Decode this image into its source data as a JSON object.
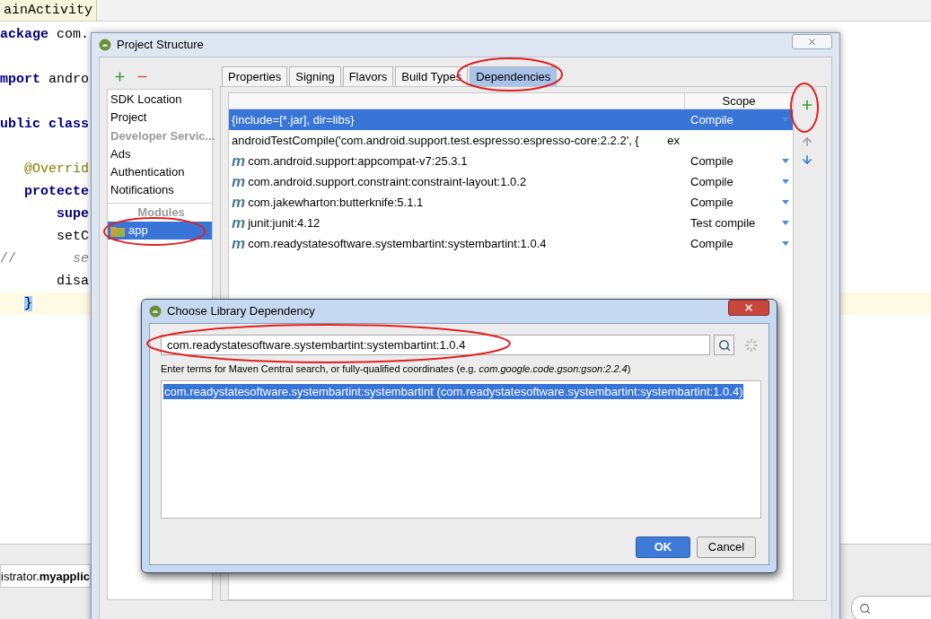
{
  "editor": {
    "tab": "ainActivity",
    "lines": [
      {
        "kind": "code",
        "current": false,
        "segments": [
          {
            "kind": "kw",
            "text": "ackage"
          },
          {
            "kind": "plain",
            "text": " com."
          }
        ]
      },
      {
        "kind": "blank",
        "current": false
      },
      {
        "kind": "code",
        "current": false,
        "segments": [
          {
            "kind": "kw",
            "text": "mport"
          },
          {
            "kind": "plain",
            "text": " andro"
          }
        ]
      },
      {
        "kind": "blank",
        "current": false
      },
      {
        "kind": "code",
        "current": false,
        "segments": [
          {
            "kind": "kw",
            "text": "ublic class"
          }
        ]
      },
      {
        "kind": "blank",
        "current": false
      },
      {
        "kind": "code",
        "current": false,
        "segments": [
          {
            "kind": "annotation",
            "text": "   @Overrid"
          }
        ]
      },
      {
        "kind": "code",
        "current": false,
        "segments": [
          {
            "kind": "kw",
            "text": "   protecte"
          }
        ]
      },
      {
        "kind": "code",
        "current": false,
        "segments": [
          {
            "kind": "kw",
            "text": "       supe"
          }
        ]
      },
      {
        "kind": "code",
        "current": false,
        "segments": [
          {
            "kind": "plain",
            "text": "       setC"
          }
        ]
      },
      {
        "kind": "code",
        "current": false,
        "segments": [
          {
            "kind": "comment",
            "text": "//"
          },
          {
            "kind": "comment_italic",
            "text": "       se"
          }
        ]
      },
      {
        "kind": "code",
        "current": false,
        "segments": [
          {
            "kind": "plain",
            "text": "       disa"
          }
        ]
      },
      {
        "kind": "code",
        "current": true,
        "segments": [
          {
            "kind": "brace",
            "text": "}"
          }
        ]
      }
    ]
  },
  "bottom_panel": {
    "tab": "istrator.**myapplic**"
  },
  "project_structure": {
    "title": "Project Structure",
    "sidebar": [
      {
        "kind": "item",
        "label": "SDK Location",
        "selected": false
      },
      {
        "kind": "item",
        "label": "Project",
        "selected": false
      },
      {
        "kind": "header",
        "label": "Developer Servic..."
      },
      {
        "kind": "item",
        "label": "Ads",
        "selected": false
      },
      {
        "kind": "item",
        "label": "Authentication",
        "selected": false
      },
      {
        "kind": "item",
        "label": "Notifications",
        "selected": false
      },
      {
        "kind": "header",
        "label": "Modules"
      },
      {
        "kind": "module",
        "label": "app",
        "selected": true
      }
    ],
    "tabs": [
      {
        "label": "Properties",
        "selected": false
      },
      {
        "label": "Signing",
        "selected": false
      },
      {
        "label": "Flavors",
        "selected": false
      },
      {
        "label": "Build Types",
        "selected": false
      },
      {
        "label": "Dependencies",
        "selected": true
      }
    ],
    "table": {
      "columns": [
        "Scope"
      ],
      "rows": [
        {
          "kind": "jar",
          "name": "{include=[*.jar], dir=libs}",
          "scope": "Compile",
          "selected": true
        },
        {
          "kind": "raw",
          "name": "androidTestCompile('com.android.support.test.espresso:espresso-core:2.2.2', {",
          "extra": "ex",
          "selected": false
        },
        {
          "kind": "maven",
          "icon_text": "m",
          "name": "com.android.support:appcompat-v7:25.3.1",
          "scope": "Compile",
          "selected": false
        },
        {
          "kind": "maven",
          "icon_text": "m",
          "name": "com.android.support.constraint:constraint-layout:1.0.2",
          "scope": "Compile",
          "selected": false
        },
        {
          "kind": "maven",
          "icon_text": "m",
          "name": "com.jakewharton:butterknife:5.1.1",
          "scope": "Compile",
          "selected": false
        },
        {
          "kind": "maven",
          "icon_text": "m",
          "name": "junit:junit:4.12",
          "scope": "Test compile",
          "selected": false
        },
        {
          "kind": "maven",
          "icon_text": "m",
          "name": "com.readystatesoftware.systembartint:systembartint:1.0.4",
          "scope": "Compile",
          "selected": false
        }
      ]
    }
  },
  "choose_dialog": {
    "title": "Choose Library Dependency",
    "search": {
      "value": "com.readystatesoftware.systembartint:systembartint:1.0.4"
    },
    "hint": "Enter terms for Maven Central search, or fully-qualified coordinates (e.g. *com.google.code.gson:gson:2.2.4*)",
    "results": [
      {
        "label": "com.readystatesoftware.systembartint:systembartint (com.readystatesoftware.systembartint:systembartint:1.0.4)",
        "selected": true
      }
    ],
    "buttons": [
      {
        "kind": "primary",
        "label": "OK"
      },
      {
        "kind": "secondary",
        "label": "Cancel"
      }
    ]
  }
}
